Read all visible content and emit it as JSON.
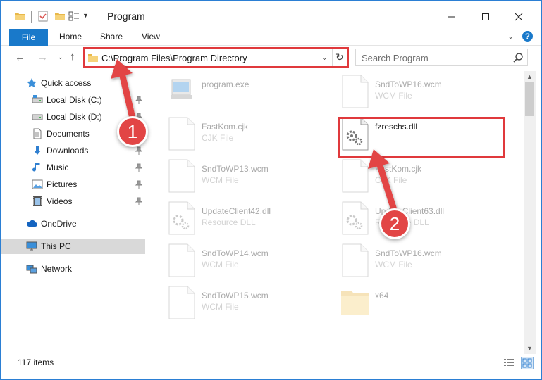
{
  "window": {
    "title": "Program"
  },
  "ribbon": {
    "file": "File",
    "home": "Home",
    "share": "Share",
    "view": "View",
    "help": "?"
  },
  "address": {
    "path": "C:\\Program Files\\Program Directory"
  },
  "search": {
    "placeholder": "Search Program"
  },
  "sidebar": {
    "quick_access": "Quick access",
    "items": [
      {
        "label": "Local Disk (C:)",
        "icon": "drive-icon",
        "pinned": true
      },
      {
        "label": "Local Disk (D:)",
        "icon": "drive-icon",
        "pinned": true
      },
      {
        "label": "Documents",
        "icon": "documents-icon",
        "pinned": true
      },
      {
        "label": "Downloads",
        "icon": "downloads-icon",
        "pinned": true
      },
      {
        "label": "Music",
        "icon": "music-icon",
        "pinned": true
      },
      {
        "label": "Pictures",
        "icon": "pictures-icon",
        "pinned": true
      },
      {
        "label": "Videos",
        "icon": "videos-icon",
        "pinned": true
      }
    ],
    "onedrive": "OneDrive",
    "this_pc": "This PC",
    "network": "Network"
  },
  "files": [
    {
      "name": "program.exe",
      "type": ""
    },
    {
      "name": "SndToWP16.wcm",
      "type": "WCM File"
    },
    {
      "name": "FastKom.cjk",
      "type": "CJK File"
    },
    {
      "name": "fzreschs.dll",
      "type": ""
    },
    {
      "name": "SndToWP13.wcm",
      "type": "WCM File"
    },
    {
      "name": "FastKom.cjk",
      "type": "CJK File"
    },
    {
      "name": "UpdateClient42.dll",
      "type": "Resource DLL"
    },
    {
      "name": "UpdateClient63.dll",
      "type": "Resource DLL"
    },
    {
      "name": "SndToWP14.wcm",
      "type": "WCM File"
    },
    {
      "name": "SndToWP16.wcm",
      "type": "WCM File"
    },
    {
      "name": "SndToWP15.wcm",
      "type": "WCM File"
    },
    {
      "name": "x64",
      "type": ""
    }
  ],
  "status": {
    "count": "117 items"
  },
  "callouts": {
    "one": "1",
    "two": "2"
  },
  "colors": {
    "accent": "#1979ca",
    "highlight": "#e0393c",
    "badge": "#e24545",
    "selected": "#d9d9d9"
  }
}
